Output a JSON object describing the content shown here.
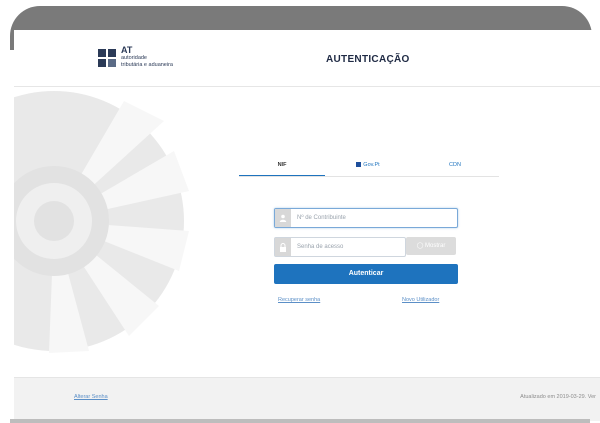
{
  "header": {
    "logo": {
      "abbr": "AT",
      "line1": "autoridade",
      "line2": "tributária e aduaneira"
    },
    "title": "AUTENTICAÇÃO"
  },
  "tabs": [
    {
      "label": "NIF",
      "active": true
    },
    {
      "label": "Gov.Pt",
      "icon": "flag-icon"
    },
    {
      "label": "CDN"
    }
  ],
  "form": {
    "nif_placeholder": "Nº de Contribuinte",
    "password_placeholder": "Senha de acesso",
    "show_label": "Mostrar",
    "submit_label": "Autenticar"
  },
  "links": {
    "recover": "Recuperar senha",
    "new_user": "Novo Utilizador"
  },
  "footer": {
    "left": "Alterar Senha",
    "right": "Atualizado em 2019-03-29. Ver"
  },
  "colors": {
    "primary": "#1e73be",
    "logo": "#2b3a57",
    "footer_bg": "#f2f2f2"
  }
}
